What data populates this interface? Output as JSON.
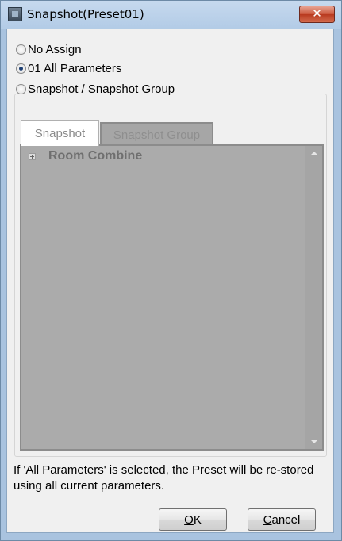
{
  "window": {
    "title": "Snapshot(Preset01)",
    "close_label": "✕"
  },
  "options": {
    "no_assign": "No Assign",
    "all_parameters": "01 All Parameters",
    "snapshot_group": "Snapshot / Snapshot Group",
    "selected": "all_parameters"
  },
  "tabs": [
    {
      "label": "Snapshot",
      "active": true
    },
    {
      "label": "Snapshot Group",
      "active": false
    }
  ],
  "tree": {
    "items": [
      {
        "label": "Room Combine",
        "expander": "+"
      }
    ]
  },
  "info_text": "If 'All Parameters' is selected, the Preset will be re-stored using all current parameters.",
  "buttons": {
    "ok_mnemonic": "O",
    "ok_rest": "K",
    "cancel_mnemonic": "C",
    "cancel_rest": "ancel"
  },
  "icons": {
    "app": "app-window-icon",
    "close": "close-icon",
    "expand": "plus-expander-icon",
    "scroll_up": "scroll-up-arrow-icon",
    "scroll_down": "scroll-down-arrow-icon"
  }
}
